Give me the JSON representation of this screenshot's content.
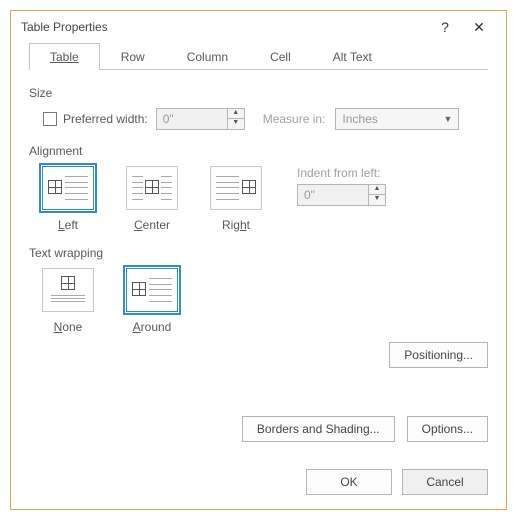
{
  "window": {
    "title": "Table Properties",
    "help_glyph": "?",
    "close_glyph": "✕"
  },
  "tabs": {
    "table": "Table",
    "row": "Row",
    "column": "Column",
    "cell": "Cell",
    "alttext": "Alt Text"
  },
  "size": {
    "section_label": "Size",
    "pref_width_label": "Preferred width:",
    "pref_width_value": "0\"",
    "measure_in_label": "Measure in:",
    "measure_in_value": "Inches"
  },
  "alignment": {
    "section_label": "Alignment",
    "left": "Left",
    "center": "Center",
    "right": "Right",
    "indent_label": "Indent from left:",
    "indent_value": "0\""
  },
  "wrap": {
    "section_label": "Text wrapping",
    "none": "None",
    "around": "Around"
  },
  "buttons": {
    "positioning": "Positioning...",
    "borders": "Borders and Shading...",
    "options": "Options...",
    "ok": "OK",
    "cancel": "Cancel"
  }
}
